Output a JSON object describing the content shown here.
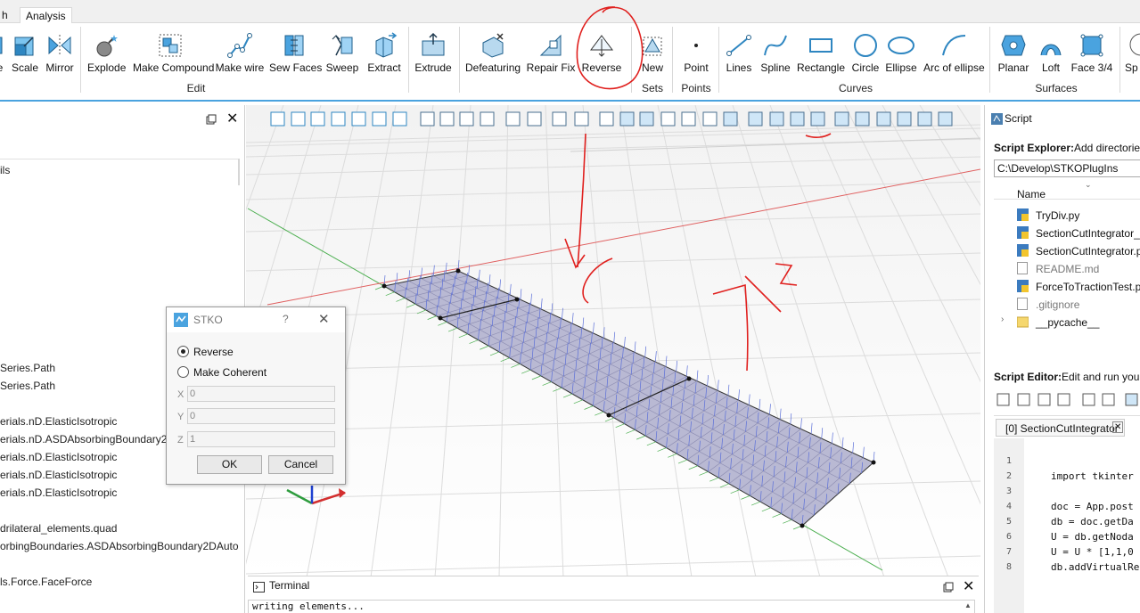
{
  "tabs": [
    "h",
    "Analysis"
  ],
  "ribbon": {
    "buttons": [
      {
        "label": "e"
      },
      {
        "label": "Scale"
      },
      {
        "label": "Mirror"
      },
      {
        "label": "Explode"
      },
      {
        "label": "Make Compound"
      },
      {
        "label": "Make wire"
      },
      {
        "label": "Sew Faces"
      },
      {
        "label": "Sweep"
      },
      {
        "label": "Extract"
      },
      {
        "label": "Extrude"
      },
      {
        "label": "Defeaturing"
      },
      {
        "label": "Repair Fix"
      },
      {
        "label": "Reverse"
      },
      {
        "label": "New"
      },
      {
        "label": "Point"
      },
      {
        "label": "Lines"
      },
      {
        "label": "Spline"
      },
      {
        "label": "Rectangle"
      },
      {
        "label": "Circle"
      },
      {
        "label": "Ellipse"
      },
      {
        "label": "Arc of ellipse"
      },
      {
        "label": "Planar"
      },
      {
        "label": "Loft"
      },
      {
        "label": "Face 3/4"
      },
      {
        "label": "Sp"
      }
    ],
    "groups": [
      "Edit",
      "Sets",
      "Points",
      "Curves",
      "Surfaces"
    ]
  },
  "left_panel": {
    "items": [
      "ils",
      "Series.Path",
      "Series.Path",
      "erials.nD.ElasticIsotropic",
      "erials.nD.ASDAbsorbingBoundary2D",
      "erials.nD.ElasticIsotropic",
      "erials.nD.ElasticIsotropic",
      "erials.nD.ElasticIsotropic",
      "drilateral_elements.quad",
      "orbingBoundaries.ASDAbsorbingBoundary2DAuto",
      "ls.Force.FaceForce"
    ]
  },
  "dialog": {
    "title": "STKO",
    "help": "?",
    "options": [
      "Reverse",
      "Make Coherent"
    ],
    "selected": "Reverse",
    "fields": [
      {
        "label": "X",
        "value": "0"
      },
      {
        "label": "Y",
        "value": "0"
      },
      {
        "label": "Z",
        "value": "1"
      }
    ],
    "ok": "OK",
    "cancel": "Cancel"
  },
  "terminal": {
    "title": "Terminal",
    "text": "writing elements..."
  },
  "right_panel": {
    "script_title": "Script",
    "explorer_label": "Script Explorer:",
    "explorer_desc": "Add directories",
    "path": "C:\\Develop\\STKOPlugIns",
    "name_header": "Name",
    "files": [
      "TryDiv.py",
      "SectionCutIntegrator_",
      "SectionCutIntegrator.p",
      "README.md",
      "ForceToTractionTest.py",
      ".gitignore",
      "__pycache__"
    ],
    "editor_label": "Script Editor:",
    "editor_desc": "Edit and run your P",
    "editor_tab": "[0] SectionCutIntegrator",
    "code_lines": [
      {
        "n": "1",
        "code": ""
      },
      {
        "n": "2",
        "code": "import tkinter"
      },
      {
        "n": "3",
        "code": ""
      },
      {
        "n": "4",
        "code": "doc = App.post"
      },
      {
        "n": "5",
        "code": "db = doc.getDa"
      },
      {
        "n": "6",
        "code": "U = db.getNoda"
      },
      {
        "n": "7",
        "code": "U = U * [1,1,0"
      },
      {
        "n": "8",
        "code": "db.addVirtualRe"
      }
    ]
  },
  "colors": {
    "accent": "#4aa3df",
    "annotation": "#e0201e",
    "mesh_fill": "#b9b9d3",
    "arrow_blue": "#5b6fd8",
    "arrow_green": "#4caf50"
  }
}
